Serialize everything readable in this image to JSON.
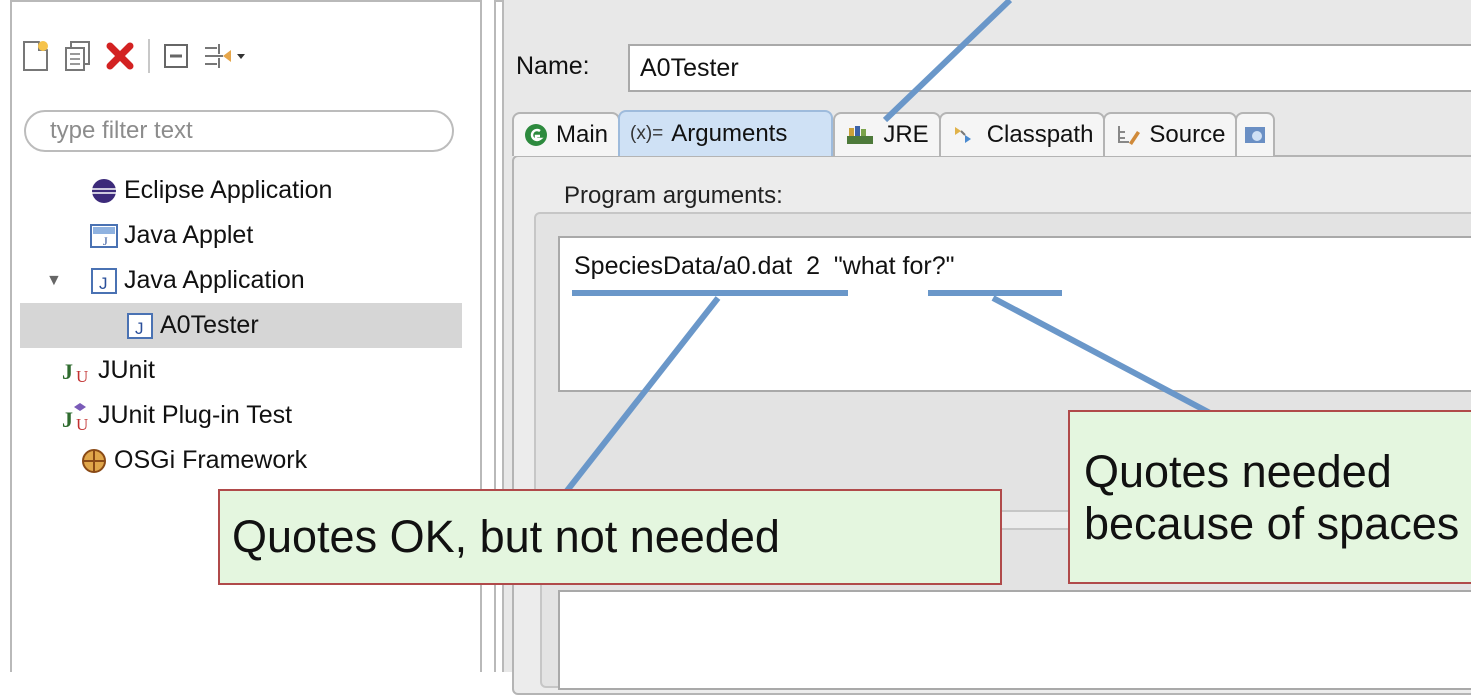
{
  "toolbar": {
    "new_icon": "new-launch-config-icon",
    "duplicate_icon": "duplicate-icon",
    "delete_icon": "delete-icon",
    "collapse_icon": "collapse-all-icon",
    "filter_icon": "filter-menu-icon"
  },
  "filter": {
    "placeholder": "type filter text"
  },
  "tree": {
    "items": [
      {
        "label": "Eclipse Application"
      },
      {
        "label": "Java Applet"
      },
      {
        "label": "Java Application"
      },
      {
        "label": "A0Tester"
      },
      {
        "label": "JUnit"
      },
      {
        "label": "JUnit Plug-in Test"
      },
      {
        "label": "OSGi Framework"
      }
    ]
  },
  "config": {
    "name_label": "Name:",
    "name_value": "A0Tester"
  },
  "tabs": [
    {
      "label": "Main",
      "icon": "main-tab-icon"
    },
    {
      "label": "Arguments",
      "prefix": "(x)=",
      "icon": "arguments-tab-icon"
    },
    {
      "label": "JRE",
      "icon": "jre-tab-icon"
    },
    {
      "label": "Classpath",
      "icon": "classpath-tab-icon"
    },
    {
      "label": "Source",
      "icon": "source-tab-icon"
    }
  ],
  "arguments": {
    "program_label": "Program arguments:",
    "program_value": "SpeciesData/a0.dat  2  \"what for?\""
  },
  "annotations": {
    "left": "Quotes OK, but not needed",
    "right_line1": "Quotes needed",
    "right_line2": "because of spaces"
  },
  "colors": {
    "annotation_line": "#6a97c9",
    "callout_fill": "#e4f6df",
    "callout_border": "#b04a4a",
    "active_tab": "#cfe1f5"
  }
}
